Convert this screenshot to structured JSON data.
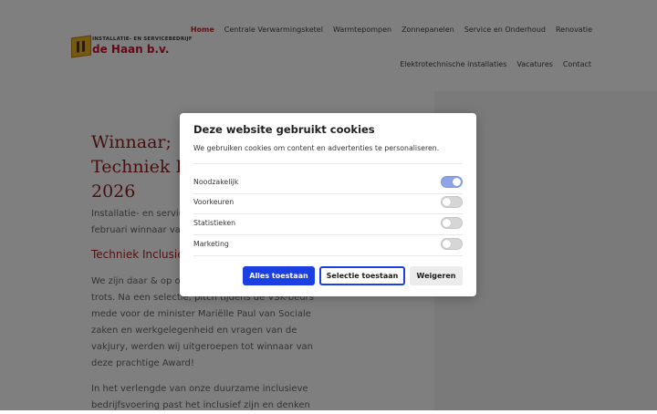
{
  "header": {
    "logo": {
      "top_text": "INSTALLATIE- EN SERVICEBEDRIJF",
      "main_text": "de Haan b.v."
    },
    "nav_row1": [
      {
        "label": "Home",
        "active": true
      },
      {
        "label": "Centrale Verwarmingsketel"
      },
      {
        "label": "Warmtepompen"
      },
      {
        "label": "Zonnepanelen"
      },
      {
        "label": "Service en Onderhoud"
      },
      {
        "label": "Renovatie"
      }
    ],
    "nav_row2": [
      {
        "label": "Elektrotechnische installaties"
      },
      {
        "label": "Vacatures"
      },
      {
        "label": "Contact"
      }
    ]
  },
  "article": {
    "heading_lines": [
      "Winnaar;",
      "Techniek Inclusief Award",
      "2026"
    ],
    "intro": "Installatie- en servicebedrijf de Haan b.v. is op 5 februari winnaar van de",
    "subheading": "Techniek Inclusief Award",
    "para1": "We zijn daar & op onze medewerkers enorm trots. Na een selectie, pitch tijdens de VSK-beurs mede voor de minister Mariëlle Paul van Sociale zaken en werkgelegenheid en vragen van de vakjury, werden wij uitgeroepen tot winnaar van deze prachtige Award!",
    "para2": "In het verlengde van onze duurzame inclusieve bedrijfsvoering past het inclusief zijn en denken"
  },
  "cookie_modal": {
    "title": "Deze website gebruikt cookies",
    "description": "We gebruiken cookies om content en advertenties te personaliseren.",
    "preferences": [
      {
        "label": "Noodzakelijk",
        "enabled": true
      },
      {
        "label": "Voorkeuren",
        "enabled": false
      },
      {
        "label": "Statistieken",
        "enabled": false
      },
      {
        "label": "Marketing",
        "enabled": false
      }
    ],
    "buttons": {
      "accept_all": "Alles toestaan",
      "accept_selection": "Selectie toestaan",
      "deny": "Weigeren"
    }
  },
  "colors": {
    "brand_red": "#8c1f1f",
    "accent_blue": "#1b3fe0",
    "toggle_on": "#8ea3e8"
  }
}
